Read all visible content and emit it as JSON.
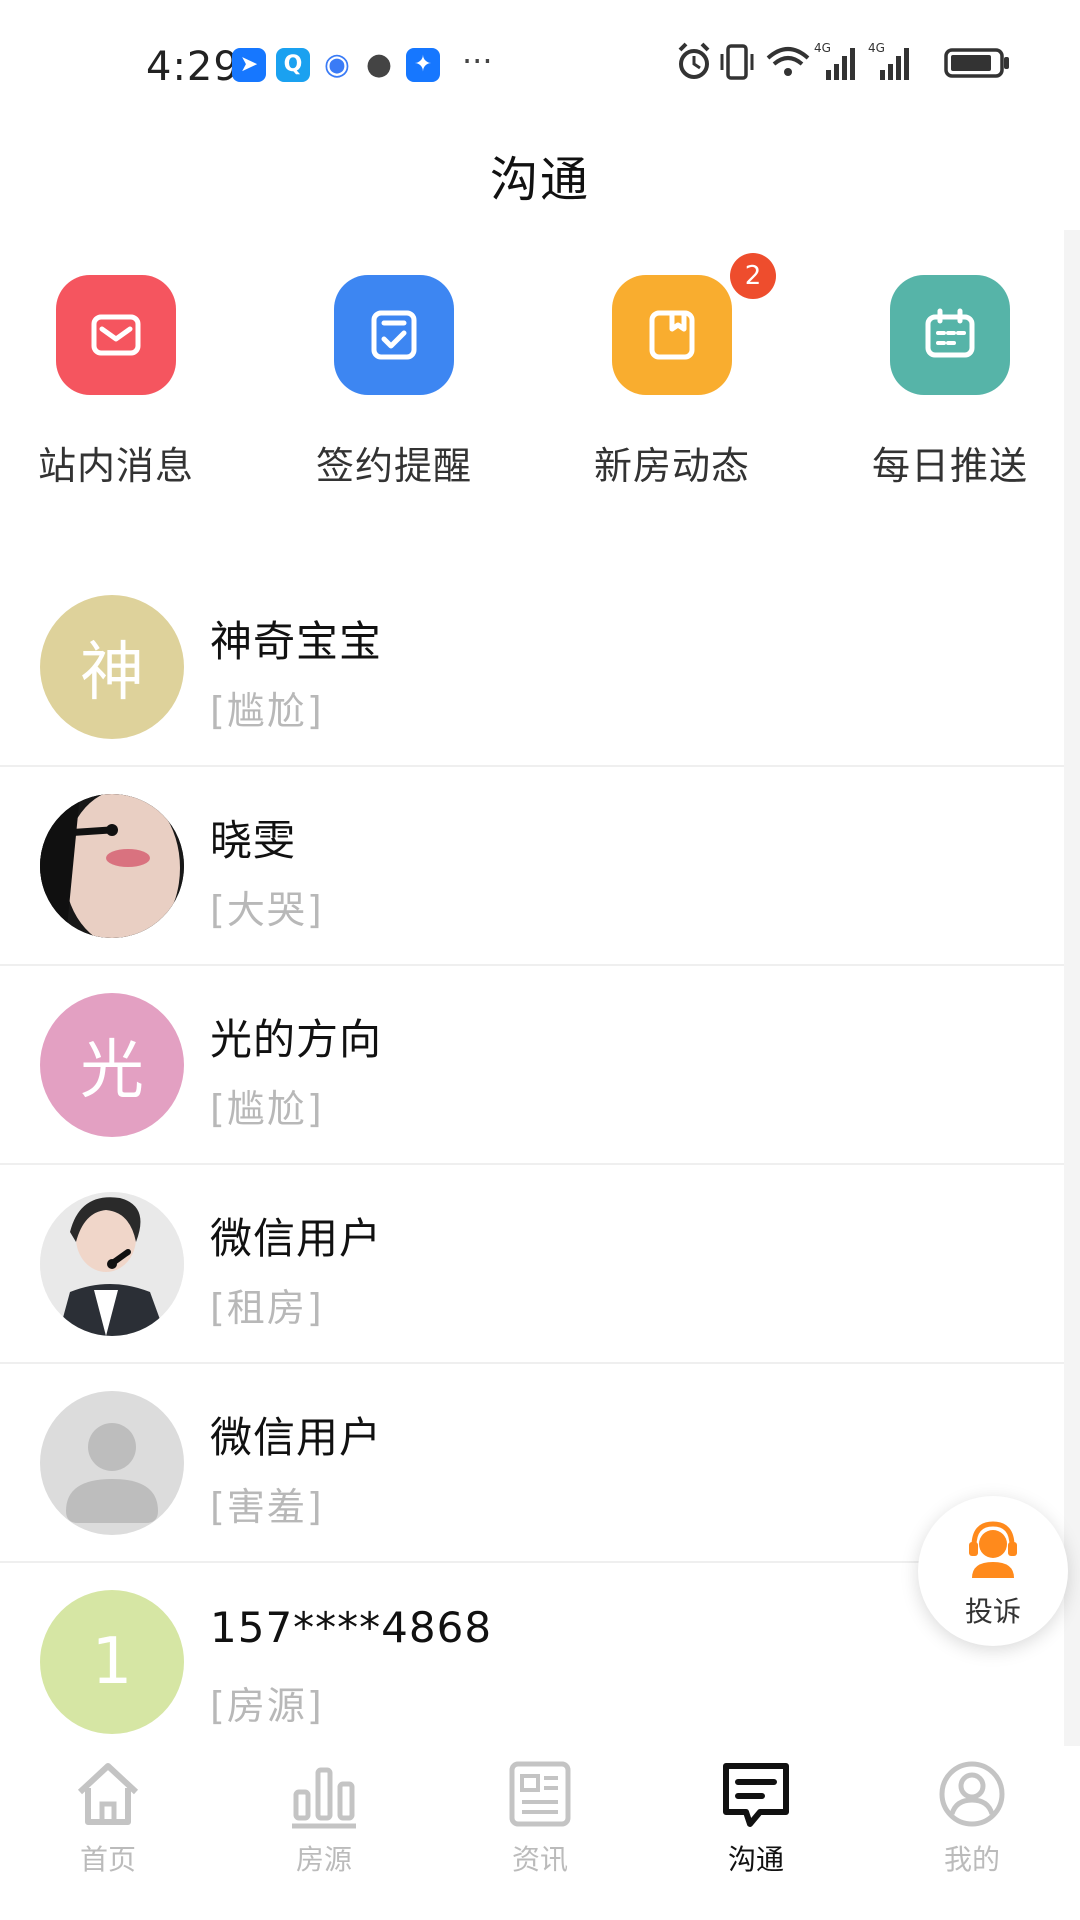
{
  "status_bar": {
    "time": "4:29",
    "more": "···",
    "network_1": "4G",
    "network_2": "4G"
  },
  "header": {
    "title": "沟通"
  },
  "quick_actions": [
    {
      "label": "站内消息",
      "icon": "mail-icon",
      "color": "#f5555f"
    },
    {
      "label": "签约提醒",
      "icon": "checklist-icon",
      "color": "#3d86f2"
    },
    {
      "label": "新房动态",
      "icon": "bookmark-icon",
      "color": "#f9ad2f",
      "badge": "2"
    },
    {
      "label": "每日推送",
      "icon": "calendar-icon",
      "color": "#56b4a8"
    }
  ],
  "conversations": [
    {
      "name": "神奇宝宝",
      "preview": "[尴尬]",
      "avatar_text": "神",
      "avatar_color": "#ded29b"
    },
    {
      "name": "晓雯",
      "preview": "[大哭]",
      "avatar_text": "",
      "avatar_type": "photo"
    },
    {
      "name": "光的方向",
      "preview": "[尴尬]",
      "avatar_text": "光",
      "avatar_color": "#e3a0c2"
    },
    {
      "name": "微信用户",
      "preview": "[租房]",
      "avatar_text": "",
      "avatar_type": "photo"
    },
    {
      "name": "微信用户",
      "preview": "[害羞]",
      "avatar_text": "",
      "avatar_type": "default"
    },
    {
      "name": "157****4868",
      "preview": "[房源]",
      "avatar_text": "1",
      "avatar_color": "#d6e6a4"
    }
  ],
  "floating": {
    "complaint_label": "投诉"
  },
  "tabbar": {
    "items": [
      {
        "label": "首页",
        "icon": "home-icon"
      },
      {
        "label": "房源",
        "icon": "bar-chart-icon"
      },
      {
        "label": "资讯",
        "icon": "news-icon"
      },
      {
        "label": "沟通",
        "icon": "chat-icon",
        "active": true
      },
      {
        "label": "我的",
        "icon": "profile-icon"
      }
    ]
  },
  "colors": {
    "accent": "#ff8a1c",
    "badge": "#ee4d2d",
    "inactive_tab": "#bbbbbb"
  }
}
